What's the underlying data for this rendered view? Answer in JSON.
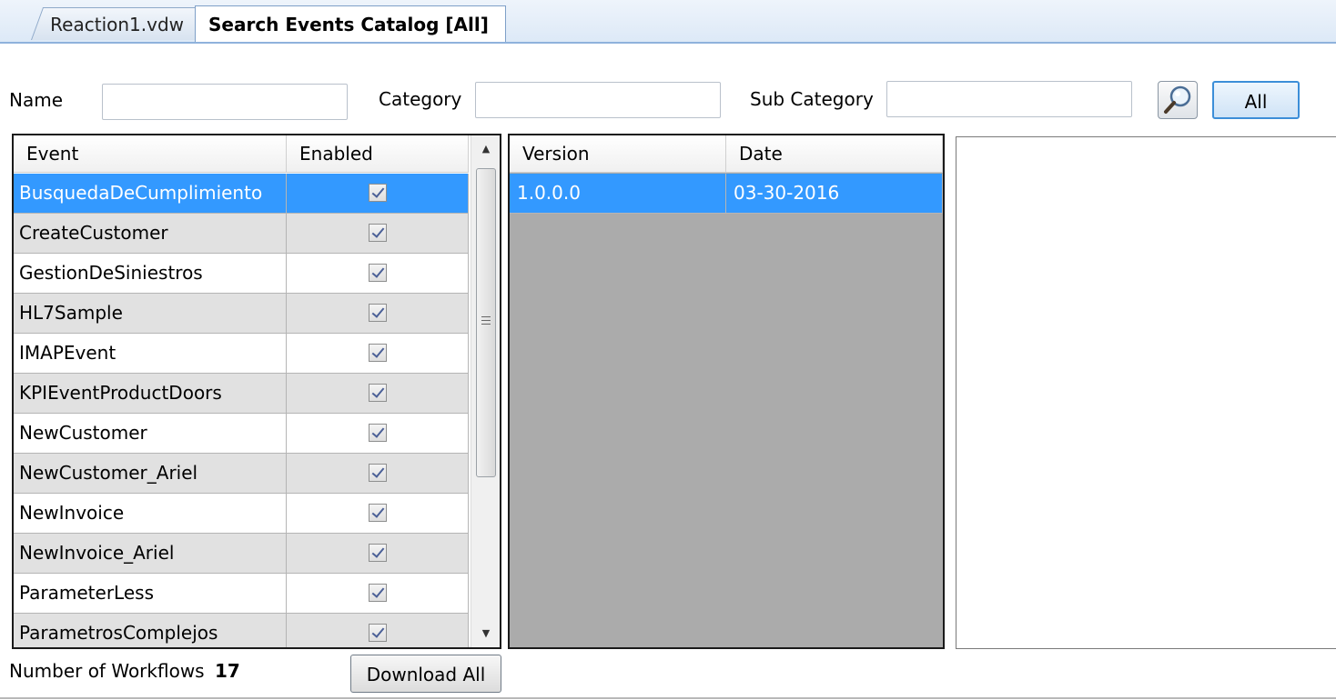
{
  "tabs": [
    {
      "label": "Reaction1.vdw"
    },
    {
      "label": "Search Events Catalog [All]"
    }
  ],
  "filters": {
    "name_label": "Name",
    "name_value": "",
    "category_label": "Category",
    "category_value": "",
    "subcategory_label": "Sub Category",
    "subcategory_value": "",
    "search_icon": "search-icon",
    "all_button": "All"
  },
  "events_grid": {
    "columns": [
      "Event",
      "Enabled"
    ],
    "rows": [
      {
        "event": "BusquedaDeCumplimiento",
        "enabled": true,
        "selected": true
      },
      {
        "event": "CreateCustomer",
        "enabled": true
      },
      {
        "event": "GestionDeSiniestros",
        "enabled": true
      },
      {
        "event": "HL7Sample",
        "enabled": true
      },
      {
        "event": "IMAPEvent",
        "enabled": true
      },
      {
        "event": "KPIEventProductDoors",
        "enabled": true
      },
      {
        "event": "NewCustomer",
        "enabled": true
      },
      {
        "event": "NewCustomer_Ariel",
        "enabled": true
      },
      {
        "event": "NewInvoice",
        "enabled": true
      },
      {
        "event": "NewInvoice_Ariel",
        "enabled": true
      },
      {
        "event": "ParameterLess",
        "enabled": true
      },
      {
        "event": "ParametrosComplejos",
        "enabled": true
      }
    ]
  },
  "versions_grid": {
    "columns": [
      "Version",
      "Date"
    ],
    "rows": [
      {
        "version": "1.0.0.0",
        "date": "03-30-2016",
        "selected": true
      }
    ]
  },
  "footer": {
    "count_label": "Number of Workflows",
    "count_value": "17",
    "download_button": "Download All"
  },
  "colors": {
    "selection": "#3399ff",
    "alt_row": "#e1e1e1",
    "empty_grid": "#ababab"
  }
}
